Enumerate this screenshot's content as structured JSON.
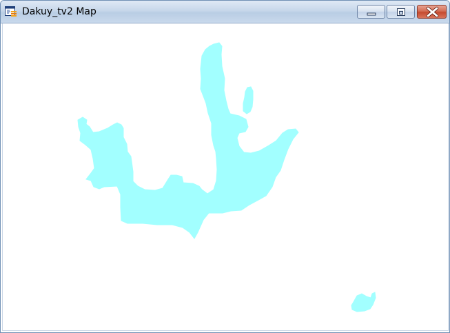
{
  "window": {
    "title": "Dakuy_tv2 Map",
    "controls": {
      "minimize_icon": "minimize-icon",
      "maximize_icon": "maximize-icon",
      "close_icon": "close-icon"
    }
  },
  "map": {
    "water_color": "#a2ffff",
    "background_color": "#ffffff",
    "features": [
      "main-lake",
      "north-inlet",
      "east-pond"
    ]
  },
  "colors": {
    "titlebar": "#c7d7ea",
    "close_button": "#c54a2f",
    "window_border": "#6f8fb4"
  }
}
